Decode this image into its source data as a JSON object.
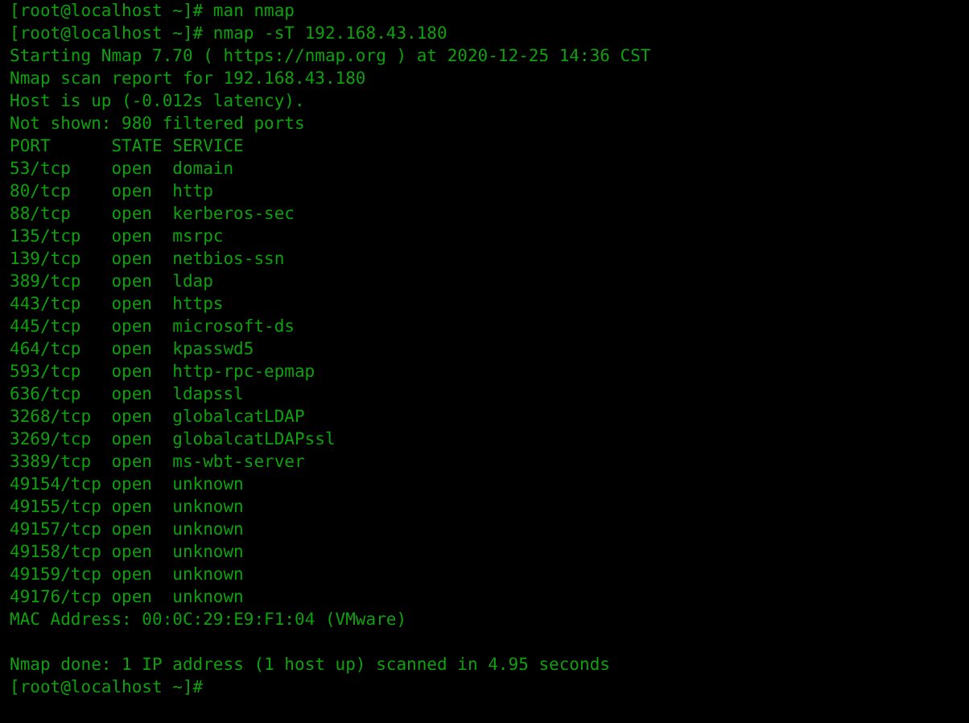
{
  "terminal": {
    "lines": [
      {
        "kind": "text",
        "text": "[root@localhost ~]# man nmap"
      },
      {
        "kind": "text",
        "text": "[root@localhost ~]# nmap -sT 192.168.43.180"
      },
      {
        "kind": "text",
        "text": "Starting Nmap 7.70 ( https://nmap.org ) at 2020-12-25 14:36 CST"
      },
      {
        "kind": "text",
        "text": "Nmap scan report for 192.168.43.180"
      },
      {
        "kind": "text",
        "text": "Host is up (-0.012s latency)."
      },
      {
        "kind": "text",
        "text": "Not shown: 980 filtered ports"
      },
      {
        "kind": "header",
        "port": "PORT",
        "state": "STATE",
        "service": "SERVICE"
      },
      {
        "kind": "port",
        "port": "53/tcp",
        "state": "open",
        "service": "domain"
      },
      {
        "kind": "port",
        "port": "80/tcp",
        "state": "open",
        "service": "http"
      },
      {
        "kind": "port",
        "port": "88/tcp",
        "state": "open",
        "service": "kerberos-sec"
      },
      {
        "kind": "port",
        "port": "135/tcp",
        "state": "open",
        "service": "msrpc"
      },
      {
        "kind": "port",
        "port": "139/tcp",
        "state": "open",
        "service": "netbios-ssn"
      },
      {
        "kind": "port",
        "port": "389/tcp",
        "state": "open",
        "service": "ldap"
      },
      {
        "kind": "port",
        "port": "443/tcp",
        "state": "open",
        "service": "https"
      },
      {
        "kind": "port",
        "port": "445/tcp",
        "state": "open",
        "service": "microsoft-ds"
      },
      {
        "kind": "port",
        "port": "464/tcp",
        "state": "open",
        "service": "kpasswd5"
      },
      {
        "kind": "port",
        "port": "593/tcp",
        "state": "open",
        "service": "http-rpc-epmap"
      },
      {
        "kind": "port",
        "port": "636/tcp",
        "state": "open",
        "service": "ldapssl"
      },
      {
        "kind": "port",
        "port": "3268/tcp",
        "state": "open",
        "service": "globalcatLDAP"
      },
      {
        "kind": "port",
        "port": "3269/tcp",
        "state": "open",
        "service": "globalcatLDAPssl"
      },
      {
        "kind": "port",
        "port": "3389/tcp",
        "state": "open",
        "service": "ms-wbt-server"
      },
      {
        "kind": "port",
        "port": "49154/tcp",
        "state": "open",
        "service": "unknown"
      },
      {
        "kind": "port",
        "port": "49155/tcp",
        "state": "open",
        "service": "unknown"
      },
      {
        "kind": "port",
        "port": "49157/tcp",
        "state": "open",
        "service": "unknown"
      },
      {
        "kind": "port",
        "port": "49158/tcp",
        "state": "open",
        "service": "unknown"
      },
      {
        "kind": "port",
        "port": "49159/tcp",
        "state": "open",
        "service": "unknown"
      },
      {
        "kind": "port",
        "port": "49176/tcp",
        "state": "open",
        "service": "unknown"
      },
      {
        "kind": "text",
        "text": "MAC Address: 00:0C:29:E9:F1:04 (VMware)"
      },
      {
        "kind": "blank"
      },
      {
        "kind": "text",
        "text": "Nmap done: 1 IP address (1 host up) scanned in 4.95 seconds"
      },
      {
        "kind": "text",
        "text": "[root@localhost ~]#"
      }
    ]
  }
}
